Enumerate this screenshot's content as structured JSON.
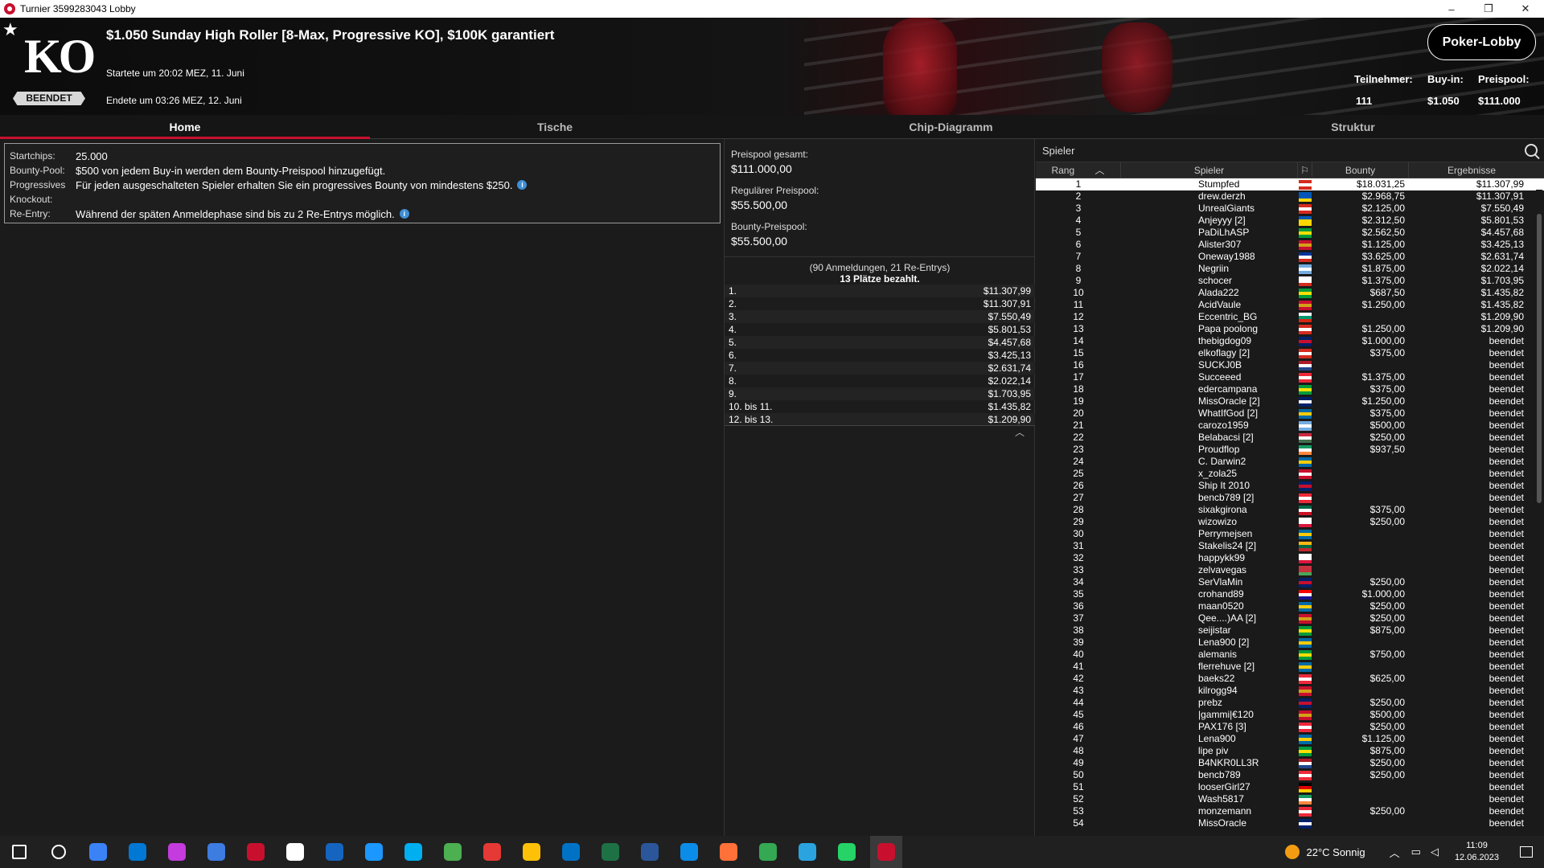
{
  "window": {
    "title": "Turnier 3599283043 Lobby",
    "minimize": "–",
    "restore": "❐",
    "close": "✕"
  },
  "header": {
    "logo": "KO",
    "status": "BEENDET",
    "title": "$1.050 Sunday High Roller [8-Max, Progressive KO], $100K garantiert",
    "started": "Startete um 20:02 MEZ, 11. Juni",
    "ended": "Endete um 03:26 MEZ, 12. Juni",
    "lobby_button": "Poker-Lobby",
    "participants_label": "Teilnehmer:",
    "participants": "111",
    "buyin_label": "Buy-in:",
    "buyin": "$1.050",
    "prizepool_label": "Preispool:",
    "prizepool": "$111.000"
  },
  "tabs": [
    "Home",
    "Tische",
    "Chip-Diagramm",
    "Struktur"
  ],
  "info": {
    "startchips_label": "Startchips:",
    "startchips": "25.000",
    "bounty_label": "Bounty-Pool:",
    "bounty": "$500 von jedem Buy-in werden dem Bounty-Preispool hinzugefügt.",
    "progressive_label": "Progressives",
    "progressive": "Für jeden ausgeschalteten Spieler erhalten Sie ein progressives Bounty von mindestens $250.",
    "knockout_label": "Knockout:",
    "reentry_label": "Re-Entry:",
    "reentry": "Während der späten Anmeldephase sind bis zu 2 Re-Entrys möglich."
  },
  "pool": {
    "total_label": "Preispool gesamt:",
    "total": "$111.000,00",
    "regular_label": "Regulärer Preispool:",
    "regular": "$55.500,00",
    "bounty_label": "Bounty-Preispool:",
    "bounty": "$55.500,00",
    "entries": "(90 Anmeldungen, 21 Re-Entrys)",
    "paid": "13 Plätze bezahlt."
  },
  "payouts": [
    {
      "place": "1.",
      "amount": "$11.307,99"
    },
    {
      "place": "2.",
      "amount": "$11.307,91"
    },
    {
      "place": "3.",
      "amount": "$7.550,49"
    },
    {
      "place": "4.",
      "amount": "$5.801,53"
    },
    {
      "place": "5.",
      "amount": "$4.457,68"
    },
    {
      "place": "6.",
      "amount": "$3.425,13"
    },
    {
      "place": "7.",
      "amount": "$2.631,74"
    },
    {
      "place": "8.",
      "amount": "$2.022,14"
    },
    {
      "place": "9.",
      "amount": "$1.703,95"
    },
    {
      "place": "10. bis 11.",
      "amount": "$1.435,82"
    },
    {
      "place": "12. bis 13.",
      "amount": "$1.209,90"
    }
  ],
  "players_panel": {
    "search_label": "Spieler",
    "col_rank": "Rang",
    "col_player": "Spieler",
    "col_bounty": "Bounty",
    "col_result": "Ergebnisse"
  },
  "players": [
    {
      "rank": "1",
      "name": "Stumpfed",
      "bounty": "$18.031,25",
      "result": "$11.307,99",
      "flag": [
        "#d52b1e",
        "#fff",
        "#d52b1e"
      ]
    },
    {
      "rank": "2",
      "name": "drew.derzh",
      "bounty": "$2.968,75",
      "result": "$11.307,91",
      "flag": [
        "#0057b7",
        "#0057b7",
        "#ffd700"
      ]
    },
    {
      "rank": "3",
      "name": "UnrealGiants",
      "bounty": "$2.125,00",
      "result": "$7.550,49",
      "flag": [
        "#d52b1e",
        "#fff",
        "#d52b1e"
      ]
    },
    {
      "rank": "4",
      "name": "Anjeyyy [2]",
      "bounty": "$2.312,50",
      "result": "$5.801,53",
      "flag": [
        "#0057b7",
        "#ffd700",
        "#ffd700"
      ]
    },
    {
      "rank": "5",
      "name": "PaDiLhASP",
      "bounty": "$2.562,50",
      "result": "$4.457,68",
      "flag": [
        "#009c3b",
        "#ffdf00",
        "#009c3b"
      ]
    },
    {
      "rank": "6",
      "name": "Alister307",
      "bounty": "$1.125,00",
      "result": "$3.425,13",
      "flag": [
        "#c8102e",
        "#d4a017",
        "#c8102e"
      ]
    },
    {
      "rank": "7",
      "name": "Oneway1988",
      "bounty": "$3.625,00",
      "result": "$2.631,74",
      "flag": [
        "#003399",
        "#fff",
        "#d52b1e"
      ]
    },
    {
      "rank": "8",
      "name": "Negriin",
      "bounty": "$1.875,00",
      "result": "$2.022,14",
      "flag": [
        "#74acdf",
        "#fff",
        "#74acdf"
      ]
    },
    {
      "rank": "9",
      "name": "schocer",
      "bounty": "$1.375,00",
      "result": "$1.703,95",
      "flag": [
        "#fff",
        "#fff",
        "#d52b1e"
      ]
    },
    {
      "rank": "10",
      "name": "Alada222",
      "bounty": "$687,50",
      "result": "$1.435,82",
      "flag": [
        "#009c3b",
        "#ffdf00",
        "#009c3b"
      ]
    },
    {
      "rank": "11",
      "name": "AcidVaule",
      "bounty": "$1.250,00",
      "result": "$1.435,82",
      "flag": [
        "#c8102e",
        "#d4a017",
        "#c8102e"
      ]
    },
    {
      "rank": "12",
      "name": "Eccentric_BG",
      "bounty": "",
      "result": "$1.209,90",
      "flag": [
        "#fff",
        "#00966e",
        "#d62612"
      ]
    },
    {
      "rank": "13",
      "name": "Papa poolong",
      "bounty": "$1.250,00",
      "result": "$1.209,90",
      "flag": [
        "#d52b1e",
        "#fff",
        "#d52b1e"
      ]
    },
    {
      "rank": "14",
      "name": "thebigdog09",
      "bounty": "$1.000,00",
      "result": "beendet",
      "flag": [
        "#012169",
        "#c8102e",
        "#012169"
      ]
    },
    {
      "rank": "15",
      "name": "elkoflagy [2]",
      "bounty": "$375,00",
      "result": "beendet",
      "flag": [
        "#d52b1e",
        "#fff",
        "#d52b1e"
      ]
    },
    {
      "rank": "16",
      "name": "SUCKJ0B",
      "bounty": "",
      "result": "beendet",
      "flag": [
        "#ae1c28",
        "#fff",
        "#21468b"
      ]
    },
    {
      "rank": "17",
      "name": "Succeeed",
      "bounty": "$1.375,00",
      "result": "beendet",
      "flag": [
        "#ed2939",
        "#fff",
        "#ed2939"
      ]
    },
    {
      "rank": "18",
      "name": "edercampana",
      "bounty": "$375,00",
      "result": "beendet",
      "flag": [
        "#009c3b",
        "#ffdf00",
        "#009c3b"
      ]
    },
    {
      "rank": "19",
      "name": "MissOracle [2]",
      "bounty": "$1.250,00",
      "result": "beendet",
      "flag": [
        "#012169",
        "#fff",
        "#012169"
      ]
    },
    {
      "rank": "20",
      "name": "WhatIfGod [2]",
      "bounty": "$375,00",
      "result": "beendet",
      "flag": [
        "#006aa7",
        "#fecc00",
        "#006aa7"
      ]
    },
    {
      "rank": "21",
      "name": "carozo1959",
      "bounty": "$500,00",
      "result": "beendet",
      "flag": [
        "#74acdf",
        "#fff",
        "#74acdf"
      ]
    },
    {
      "rank": "22",
      "name": "Belabacsi [2]",
      "bounty": "$250,00",
      "result": "beendet",
      "flag": [
        "#cd2a3e",
        "#fff",
        "#436f4d"
      ]
    },
    {
      "rank": "23",
      "name": "Proudflop",
      "bounty": "$937,50",
      "result": "beendet",
      "flag": [
        "#169b62",
        "#fff",
        "#ff883e"
      ]
    },
    {
      "rank": "24",
      "name": "C. Darwin2",
      "bounty": "",
      "result": "beendet",
      "flag": [
        "#006aa7",
        "#fecc00",
        "#006aa7"
      ]
    },
    {
      "rank": "25",
      "name": "x_zola25",
      "bounty": "",
      "result": "beendet",
      "flag": [
        "#c8102e",
        "#fff",
        "#c8102e"
      ]
    },
    {
      "rank": "26",
      "name": "Ship It 2010",
      "bounty": "",
      "result": "beendet",
      "flag": [
        "#012169",
        "#c8102e",
        "#012169"
      ]
    },
    {
      "rank": "27",
      "name": "bencb789 [2]",
      "bounty": "",
      "result": "beendet",
      "flag": [
        "#ed2939",
        "#fff",
        "#ed2939"
      ]
    },
    {
      "rank": "28",
      "name": "sixakgirona",
      "bounty": "$375,00",
      "result": "beendet",
      "flag": [
        "#006847",
        "#fff",
        "#ce1126"
      ]
    },
    {
      "rank": "29",
      "name": "wizowizo",
      "bounty": "$250,00",
      "result": "beendet",
      "flag": [
        "#fff",
        "#fff",
        "#dc143c"
      ]
    },
    {
      "rank": "30",
      "name": "Perrymejsen",
      "bounty": "",
      "result": "beendet",
      "flag": [
        "#006aa7",
        "#fecc00",
        "#006aa7"
      ]
    },
    {
      "rank": "31",
      "name": "Stakelis24 [2]",
      "bounty": "",
      "result": "beendet",
      "flag": [
        "#fdb913",
        "#006a44",
        "#c1272d"
      ]
    },
    {
      "rank": "32",
      "name": "happykk99",
      "bounty": "",
      "result": "beendet",
      "flag": [
        "#fff",
        "#fff",
        "#dc143c"
      ]
    },
    {
      "rank": "33",
      "name": "zelvavegas",
      "bounty": "",
      "result": "beendet",
      "flag": [
        "#c8313e",
        "#c8313e",
        "#4aa657"
      ]
    },
    {
      "rank": "34",
      "name": "SerVlaMin",
      "bounty": "$250,00",
      "result": "beendet",
      "flag": [
        "#012169",
        "#c8102e",
        "#012169"
      ]
    },
    {
      "rank": "35",
      "name": "crohand89",
      "bounty": "$1.000,00",
      "result": "beendet",
      "flag": [
        "#ff0000",
        "#fff",
        "#171796"
      ]
    },
    {
      "rank": "36",
      "name": "maan0520",
      "bounty": "$250,00",
      "result": "beendet",
      "flag": [
        "#006aa7",
        "#fecc00",
        "#006aa7"
      ]
    },
    {
      "rank": "37",
      "name": "Qee....)AA [2]",
      "bounty": "$250,00",
      "result": "beendet",
      "flag": [
        "#c8102e",
        "#d4a017",
        "#c8102e"
      ]
    },
    {
      "rank": "38",
      "name": "seijistar",
      "bounty": "$875,00",
      "result": "beendet",
      "flag": [
        "#009c3b",
        "#ffdf00",
        "#009c3b"
      ]
    },
    {
      "rank": "39",
      "name": "Lena900 [2]",
      "bounty": "",
      "result": "beendet",
      "flag": [
        "#006aa7",
        "#fecc00",
        "#006aa7"
      ]
    },
    {
      "rank": "40",
      "name": "alemanis",
      "bounty": "$750,00",
      "result": "beendet",
      "flag": [
        "#009c3b",
        "#ffdf00",
        "#009c3b"
      ]
    },
    {
      "rank": "41",
      "name": "flerrehuve [2]",
      "bounty": "",
      "result": "beendet",
      "flag": [
        "#006aa7",
        "#fecc00",
        "#006aa7"
      ]
    },
    {
      "rank": "42",
      "name": "baeks22",
      "bounty": "$625,00",
      "result": "beendet",
      "flag": [
        "#ed2939",
        "#fff",
        "#ed2939"
      ]
    },
    {
      "rank": "43",
      "name": "kilrogg94",
      "bounty": "",
      "result": "beendet",
      "flag": [
        "#c8102e",
        "#d4a017",
        "#c8102e"
      ]
    },
    {
      "rank": "44",
      "name": "prebz",
      "bounty": "$250,00",
      "result": "beendet",
      "flag": [
        "#012169",
        "#c8102e",
        "#012169"
      ]
    },
    {
      "rank": "45",
      "name": "|gammi|€120",
      "bounty": "$500,00",
      "result": "beendet",
      "flag": [
        "#c8102e",
        "#d4a017",
        "#c8102e"
      ]
    },
    {
      "rank": "46",
      "name": "PAX176 [3]",
      "bounty": "$250,00",
      "result": "beendet",
      "flag": [
        "#ed2939",
        "#fff",
        "#ed2939"
      ]
    },
    {
      "rank": "47",
      "name": "Lena900",
      "bounty": "$1.125,00",
      "result": "beendet",
      "flag": [
        "#006aa7",
        "#fecc00",
        "#006aa7"
      ]
    },
    {
      "rank": "48",
      "name": "lipe piv",
      "bounty": "$875,00",
      "result": "beendet",
      "flag": [
        "#009c3b",
        "#ffdf00",
        "#009c3b"
      ]
    },
    {
      "rank": "49",
      "name": "B4NKR0LL3R",
      "bounty": "$250,00",
      "result": "beendet",
      "flag": [
        "#ae1c28",
        "#fff",
        "#21468b"
      ]
    },
    {
      "rank": "50",
      "name": "bencb789",
      "bounty": "$250,00",
      "result": "beendet",
      "flag": [
        "#ed2939",
        "#fff",
        "#ed2939"
      ]
    },
    {
      "rank": "51",
      "name": "looserGirl27",
      "bounty": "",
      "result": "beendet",
      "flag": [
        "#000",
        "#dd0000",
        "#ffce00"
      ]
    },
    {
      "rank": "52",
      "name": "Wash5817",
      "bounty": "",
      "result": "beendet",
      "flag": [
        "#169b62",
        "#fff",
        "#ff883e"
      ]
    },
    {
      "rank": "53",
      "name": "monzemann",
      "bounty": "$250,00",
      "result": "beendet",
      "flag": [
        "#ed2939",
        "#fff",
        "#ed2939"
      ]
    },
    {
      "rank": "54",
      "name": "MissOracle",
      "bounty": "",
      "result": "beendet",
      "flag": [
        "#012169",
        "#fff",
        "#012169"
      ]
    }
  ],
  "taskbar": {
    "apps": [
      "windows-start",
      "search",
      "cortana",
      "onedrive",
      "music",
      "vpn",
      "mcafee",
      "gog-galaxy",
      "sky-go",
      "prime-video",
      "skype",
      "chrome",
      "chrome-2",
      "file-explorer",
      "outlook",
      "excel",
      "word",
      "edge",
      "firefox",
      "chrome-3",
      "telegram",
      "whatsapp",
      "pokerstars"
    ],
    "app_colors": [
      "#ffffff",
      "#ffffff",
      "#3b82f6",
      "#0078d4",
      "#c43bde",
      "#3d7ce0",
      "#c8102e",
      "#ffffff",
      "#1565c0",
      "#1a98ff",
      "#00aff0",
      "#4caf50",
      "#e53935",
      "#ffc107",
      "#0072c6",
      "#1e7145",
      "#2b579a",
      "#0c8ce9",
      "#ff7139",
      "#34a853",
      "#2aa3df",
      "#25d366",
      "#c8102e"
    ],
    "weather": "22°C Sonnig",
    "time": "11:09",
    "date": "12.06.2023"
  }
}
